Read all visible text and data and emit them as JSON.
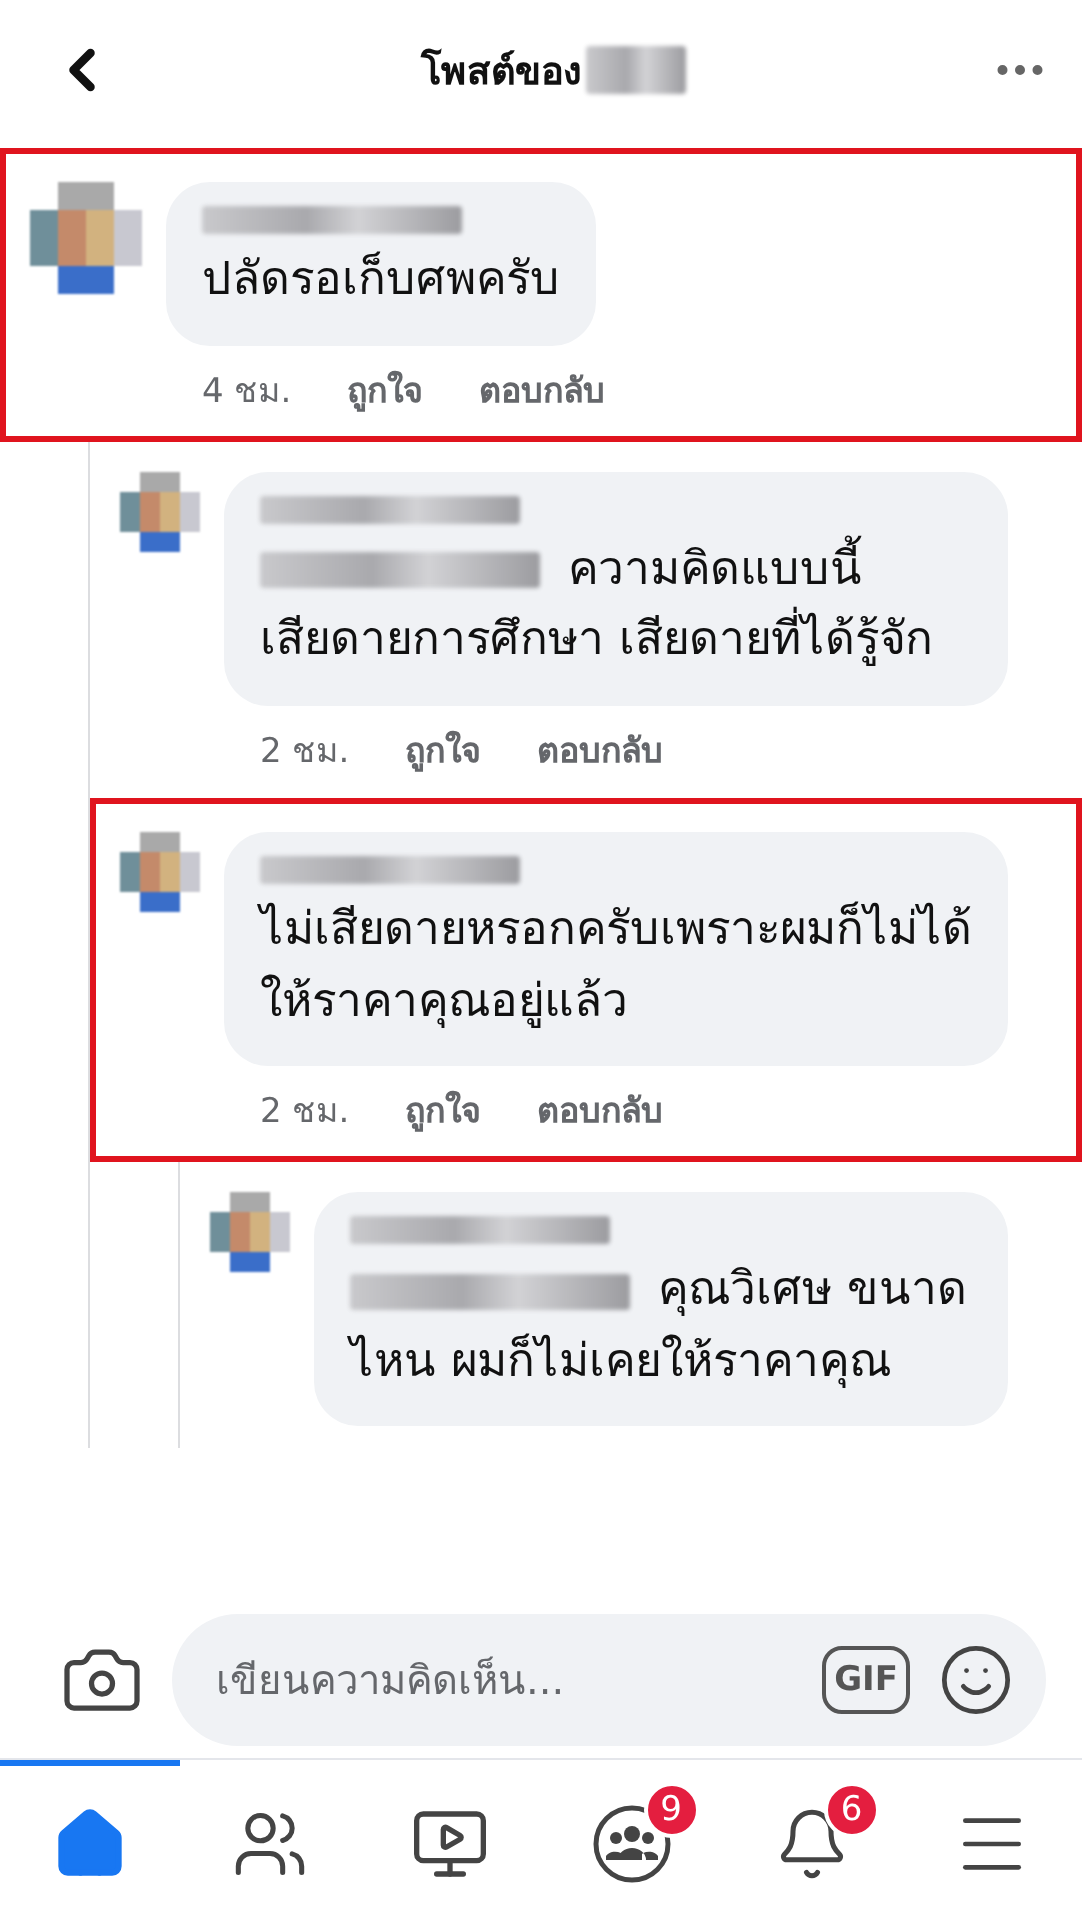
{
  "header": {
    "title": "โพสต์ของ",
    "name_hidden": true
  },
  "comments": [
    {
      "highlighted": true,
      "name_hidden": true,
      "mention": false,
      "body": "ปลัดรอเก็บศพครับ",
      "time": "4 ชม.",
      "like": "ถูกใจ",
      "reply": "ตอบกลับ",
      "children": [
        {
          "highlighted": false,
          "name_hidden": true,
          "mention": true,
          "body": "ความคิดแบบนี้ เสียดายการศึกษา เสียดายที่ได้รู้จัก",
          "time": "2 ชม.",
          "like": "ถูกใจ",
          "reply": "ตอบกลับ"
        },
        {
          "highlighted": true,
          "name_hidden": true,
          "mention": false,
          "body": "ไม่เสียดายหรอกครับเพราะผมก็ไม่ได้ให้ราคาคุณอยู่แล้ว",
          "time": "2 ชม.",
          "like": "ถูกใจ",
          "reply": "ตอบกลับ",
          "children": [
            {
              "highlighted": false,
              "name_hidden": true,
              "mention": true,
              "body": "คุณวิเศษ ขนาดไหน ผมก็ไม่เคยให้ราคาคุณ"
            }
          ]
        }
      ]
    }
  ],
  "composer": {
    "placeholder": "เขียนความคิดเห็น...",
    "gif": "GIF"
  },
  "nav": [
    {
      "kind": "home",
      "selected": true
    },
    {
      "kind": "friends",
      "selected": false
    },
    {
      "kind": "watch",
      "selected": false
    },
    {
      "kind": "groups",
      "selected": false,
      "badge": "9"
    },
    {
      "kind": "notifications",
      "selected": false,
      "badge": "6"
    },
    {
      "kind": "menu",
      "selected": false
    }
  ]
}
